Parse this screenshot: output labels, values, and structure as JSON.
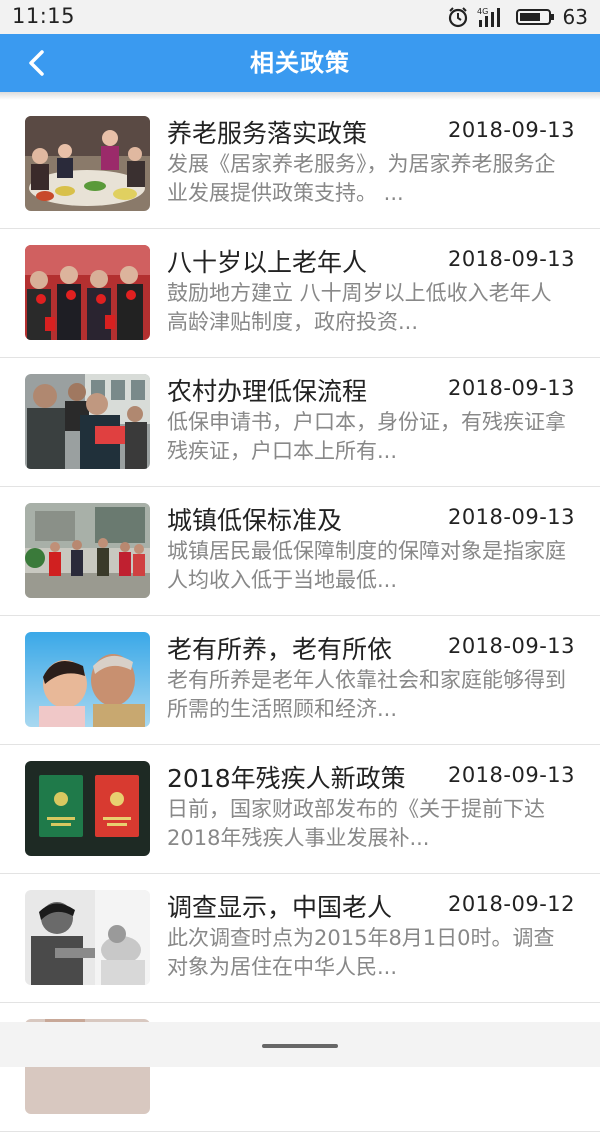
{
  "status_bar": {
    "time": "11:15",
    "network": "4G",
    "battery": "63"
  },
  "header": {
    "title": "相关政策"
  },
  "colors": {
    "header_bg": "#3a9af0",
    "title_text": "#222222",
    "summary_text": "#888888"
  },
  "items": [
    {
      "title": "养老服务落实政策",
      "date": "2018-09-13",
      "summary": "发展《居家养老服务》，为居家养老服务企业发展提供政策支持。 ..."
    },
    {
      "title": "八十岁以上老年人",
      "date": "2018-09-13",
      "summary": "鼓励地方建立 八十周岁以上低收入老年人 高龄津贴制度，政府投资..."
    },
    {
      "title": "农村办理低保流程",
      "date": "2018-09-13",
      "summary": "低保申请书，户口本，身份证，有残疾证拿残疾证，户口本上所有..."
    },
    {
      "title": "城镇低保标准及",
      "date": "2018-09-13",
      "summary": "城镇居民最低保障制度的保障对象是指家庭人均收入低于当地最低..."
    },
    {
      "title": "老有所养，老有所依",
      "date": "2018-09-13",
      "summary": "老有所养是老年人依靠社会和家庭能够得到所需的生活照顾和经济..."
    },
    {
      "title": "2018年残疾人新政策",
      "date": "2018-09-13",
      "summary": "日前，国家财政部发布的《关于提前下达2018年残疾人事业发展补..."
    },
    {
      "title": "调查显示，中国老人",
      "date": "2018-09-12",
      "summary": "此次调查时点为2015年8月1日0时。调查对象为居住在中华人民..."
    }
  ]
}
